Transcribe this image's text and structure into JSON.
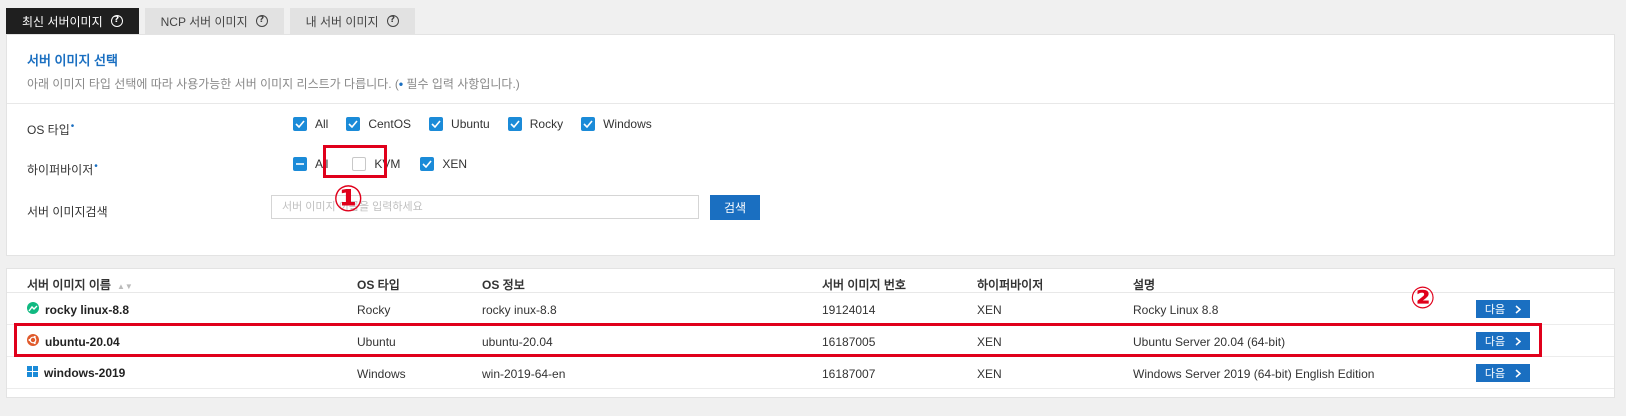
{
  "tabs": [
    {
      "label": "최신 서버이미지",
      "active": true
    },
    {
      "label": "NCP 서버 이미지",
      "active": false
    },
    {
      "label": "내 서버 이미지",
      "active": false
    }
  ],
  "section": {
    "title": "서버 이미지 선택",
    "desc_prefix": "아래 이미지 타입 선택에 따라 사용가능한 서버 이미지 리스트가 다릅니다. (",
    "desc_dot": "•",
    "desc_suffix": " 필수 입력 사항입니다.)"
  },
  "os_type": {
    "label": "OS 타입",
    "required_mark": "•",
    "options": [
      {
        "label": "All",
        "state": "checked"
      },
      {
        "label": "CentOS",
        "state": "checked"
      },
      {
        "label": "Ubuntu",
        "state": "checked"
      },
      {
        "label": "Rocky",
        "state": "checked"
      },
      {
        "label": "Windows",
        "state": "checked"
      }
    ]
  },
  "hypervisor": {
    "label": "하이퍼바이저",
    "required_mark": "•",
    "options": [
      {
        "label": "All",
        "state": "indeterminate"
      },
      {
        "label": "KVM",
        "state": "unchecked"
      },
      {
        "label": "XEN",
        "state": "checked"
      }
    ]
  },
  "search": {
    "label": "서버 이미지검색",
    "placeholder": "서버 이미지 이름을 입력하세요",
    "button": "검색"
  },
  "annotations": {
    "one": "①",
    "two": "②"
  },
  "table": {
    "headers": {
      "name": "서버 이미지 이름",
      "sort": "▲▼",
      "os_type": "OS 타입",
      "os_info": "OS 정보",
      "number": "서버 이미지 번호",
      "hypervisor": "하이퍼바이저",
      "desc": "설명"
    },
    "rows": [
      {
        "name": "rocky linux-8.8",
        "os_type": "Rocky",
        "os_info": "rocky inux-8.8",
        "number": "19124014",
        "hypervisor": "XEN",
        "desc": "Rocky Linux 8.8",
        "button": "다음",
        "icon": "rocky-icon"
      },
      {
        "name": "ubuntu-20.04",
        "os_type": "Ubuntu",
        "os_info": "ubuntu-20.04",
        "number": "16187005",
        "hypervisor": "XEN",
        "desc": "Ubuntu Server 20.04 (64-bit)",
        "button": "다음",
        "icon": "ubuntu-icon"
      },
      {
        "name": "windows-2019",
        "os_type": "Windows",
        "os_info": "win-2019-64-en",
        "number": "16187007",
        "hypervisor": "XEN",
        "desc": "Windows Server 2019 (64-bit) English Edition",
        "button": "다음",
        "icon": "windows-icon"
      }
    ]
  },
  "colors": {
    "accent": "#1a6fc1",
    "checkbox": "#1b8bd8",
    "highlight": "#e0001b"
  }
}
